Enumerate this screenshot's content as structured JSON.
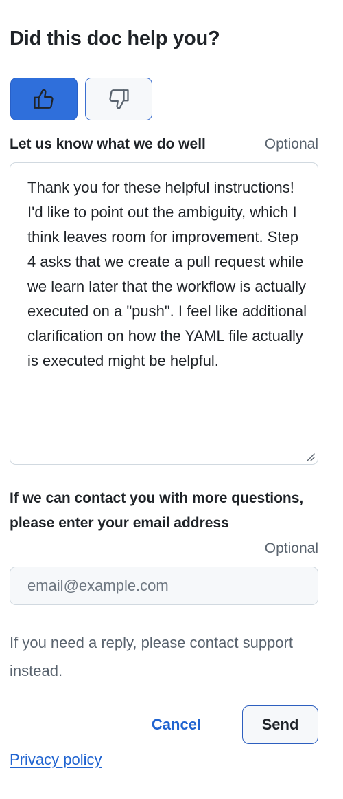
{
  "feedback": {
    "title": "Did this doc help you?",
    "thumbs_up_icon": "thumbs-up-icon",
    "thumbs_down_icon": "thumbs-down-icon",
    "selected_vote": "up",
    "well_label": "Let us know what we do well",
    "well_optional": "Optional",
    "well_text": "Thank you for these helpful instructions! I'd like to point out the ambiguity, which I think leaves room for improvement. Step 4 asks that we create a pull request while we learn later that the workflow is actually executed on a \"push\". I feel like additional clarification on how the YAML file actually is executed might be helpful.",
    "email_label": "If we can contact you with more questions, please enter your email address",
    "email_optional": "Optional",
    "email_value": "",
    "email_placeholder": "email@example.com",
    "help_text": "If you need a reply, please contact support instead.",
    "cancel_label": "Cancel",
    "send_label": "Send",
    "privacy_label": "Privacy policy",
    "colors": {
      "accent": "#2f6fdb",
      "link": "#1f63d0",
      "muted": "#59636e",
      "border": "#d1d9e0"
    }
  }
}
